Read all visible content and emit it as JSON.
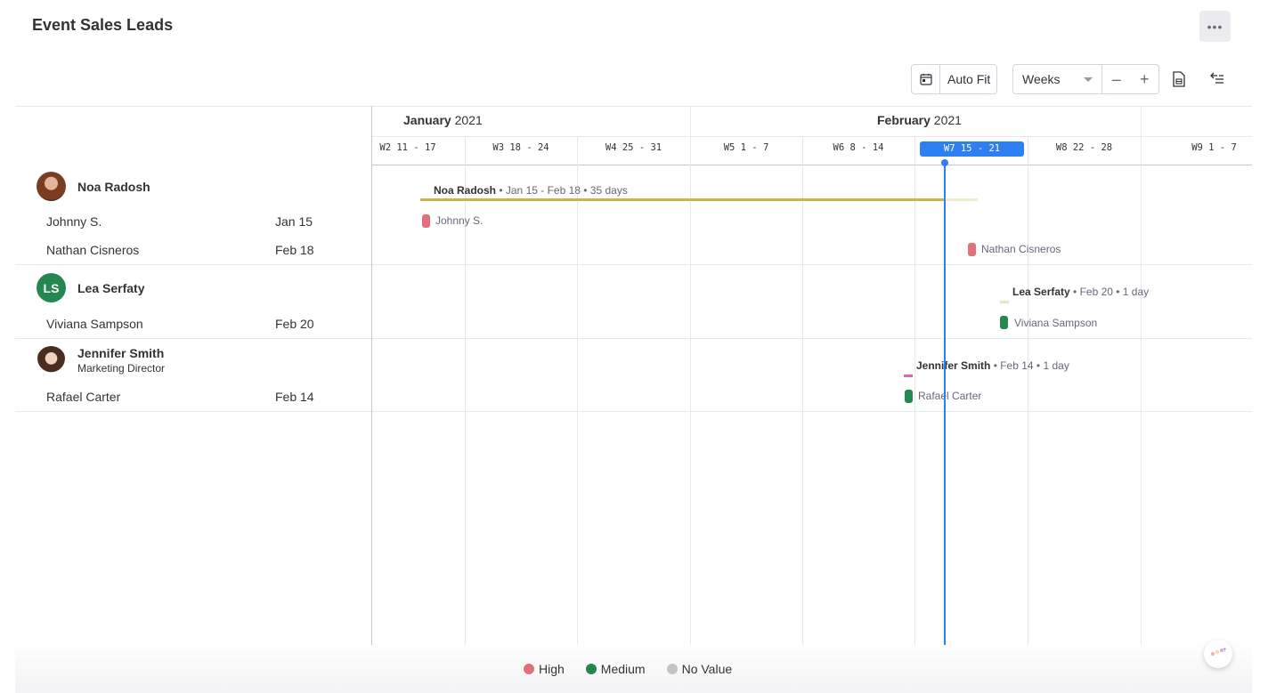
{
  "header": {
    "title": "Event Sales Leads",
    "more_label": "•••"
  },
  "toolbar": {
    "auto_fit_label": "Auto Fit",
    "scale_selected": "Weeks",
    "zoom_out": "–",
    "zoom_in": "+"
  },
  "timeline": {
    "months": [
      {
        "name": "January",
        "year": " 2021"
      },
      {
        "name": "February",
        "year": " 2021"
      }
    ],
    "weeks": [
      "W2  11 - 17",
      "W3  18 - 24",
      "W4  25 - 31",
      "W5  1 - 7",
      "W6  8 - 14",
      "W7  15 - 21",
      "W8  22 - 28",
      "W9  1 - 7"
    ],
    "current_week": "W7  15 - 21"
  },
  "groups": [
    {
      "name": "Noa Radosh",
      "bar_name": "Noa Radosh",
      "bar_detail": " • Jan 15 - Feb 18 • 35 days",
      "bar_color": "#c9b34c",
      "items": [
        {
          "name": "Johnny S.",
          "date": "Jan 15",
          "priority_color": "#e2707a",
          "label": "Johnny S."
        },
        {
          "name": "Nathan Cisneros",
          "date": "Feb 18",
          "priority_color": "#e2707a",
          "label": "Nathan Cisneros"
        }
      ]
    },
    {
      "name": "Lea Serfaty",
      "initials": "LS",
      "bar_name": "Lea Serfaty",
      "bar_detail": " • Feb 20 • 1 day",
      "bar_color": "#e8e6c6",
      "items": [
        {
          "name": "Viviana Sampson",
          "date": "Feb 20",
          "priority_color": "#258750",
          "label": "Viviana Sampson"
        }
      ]
    },
    {
      "name": "Jennifer Smith",
      "subtitle": "Marketing Director",
      "bar_name": "Jennifer Smith",
      "bar_detail": " • Feb 14 • 1 day",
      "bar_color": "#e85fb0",
      "items": [
        {
          "name": "Rafael Carter",
          "date": "Feb 14",
          "priority_color": "#258750",
          "label": "Rafael Carter"
        }
      ]
    }
  ],
  "legend": [
    {
      "label": "High",
      "color": "#e2707a"
    },
    {
      "label": "Medium",
      "color": "#258750"
    },
    {
      "label": "No Value",
      "color": "#c4c4c4"
    }
  ],
  "icons": [
    "more-icon",
    "calendar-icon",
    "caret-down-icon",
    "export-doc-icon",
    "collapse-icon",
    "assistant-icon"
  ]
}
